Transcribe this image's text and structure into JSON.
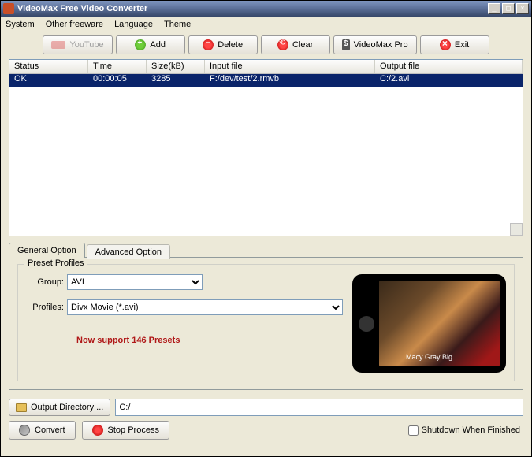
{
  "window": {
    "title": "VideoMax Free Video Converter"
  },
  "menu": [
    "System",
    "Other freeware",
    "Language",
    "Theme"
  ],
  "toolbar": {
    "youtube": "YouTube",
    "add": "Add",
    "delete": "Delete",
    "clear": "Clear",
    "pro": "VideoMax Pro",
    "exit": "Exit"
  },
  "list": {
    "headers": [
      "Status",
      "Time",
      "Size(kB)",
      "Input file",
      "Output file"
    ],
    "rows": [
      {
        "status": "OK",
        "time": "00:00:05",
        "size": "3285",
        "input": "F:/dev/test/2.rmvb",
        "output": "C:/2.avi"
      }
    ]
  },
  "tabs": [
    "General Option",
    "Advanced Option"
  ],
  "preset": {
    "legend": "Preset Profiles",
    "group_label": "Group:",
    "group_value": "AVI",
    "profiles_label": "Profiles:",
    "profiles_value": "Divx Movie (*.avi)",
    "note": "Now support 146 Presets",
    "preview_caption": "Macy Gray\nBig"
  },
  "output": {
    "button": "Output Directory ...",
    "path": "C:/"
  },
  "actions": {
    "convert": "Convert",
    "stop": "Stop Process",
    "shutdown": "Shutdown When Finished"
  }
}
